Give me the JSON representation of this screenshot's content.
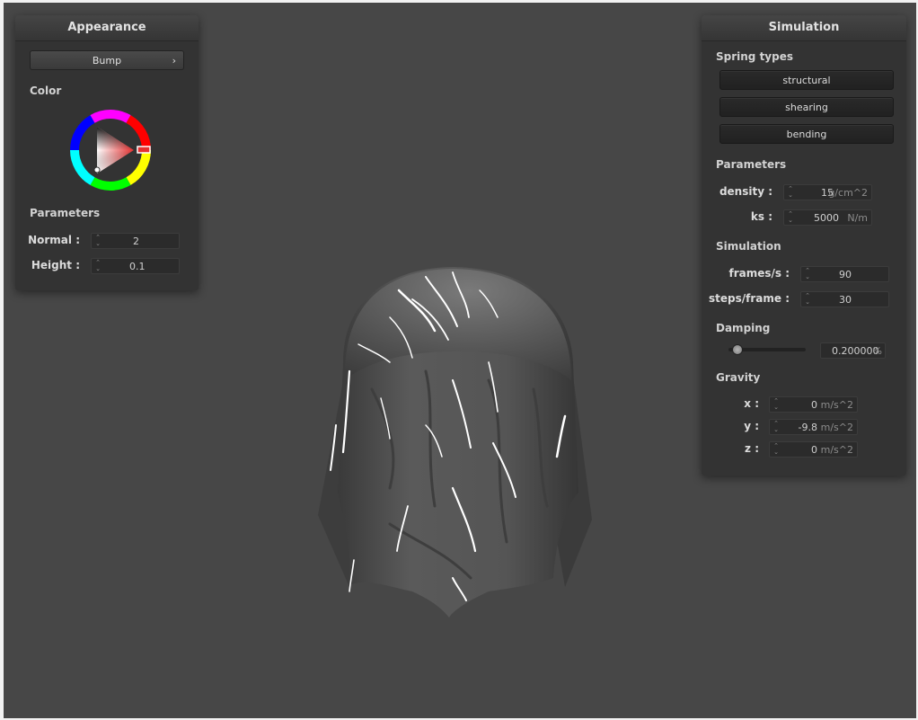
{
  "appearance": {
    "title": "Appearance",
    "shader_selected": "Bump",
    "color_label": "Color",
    "parameters_label": "Parameters",
    "normal": {
      "label": "Normal :",
      "value": "2"
    },
    "height": {
      "label": "Height :",
      "value": "0.1"
    }
  },
  "simulation": {
    "title": "Simulation",
    "spring_types_label": "Spring types",
    "springs": [
      "structural",
      "shearing",
      "bending"
    ],
    "parameters_label": "Parameters",
    "density": {
      "label": "density :",
      "value": "15",
      "unit": "g/cm^2"
    },
    "ks": {
      "label": "ks :",
      "value": "5000",
      "unit": "N/m"
    },
    "simulation_label": "Simulation",
    "frames_per_s": {
      "label": "frames/s :",
      "value": "90"
    },
    "steps_per_frame": {
      "label": "steps/frame :",
      "value": "30"
    },
    "damping_label": "Damping",
    "damping": {
      "value": "0.200000",
      "unit": "%",
      "slider_fraction": 0.1
    },
    "gravity_label": "Gravity",
    "gravity_x": {
      "label": "x :",
      "value": "0",
      "unit": "m/s^2"
    },
    "gravity_y": {
      "label": "y :",
      "value": "-9.8",
      "unit": "m/s^2"
    },
    "gravity_z": {
      "label": "z :",
      "value": "0",
      "unit": "m/s^2"
    }
  },
  "colors": {
    "background": "#474747",
    "panel": "#333333",
    "cloth": "#5a5a5a",
    "picked_color": "#e53030"
  },
  "icons": [
    "chevron-right-icon",
    "spinner-arrows-icon",
    "color-wheel-icon"
  ]
}
